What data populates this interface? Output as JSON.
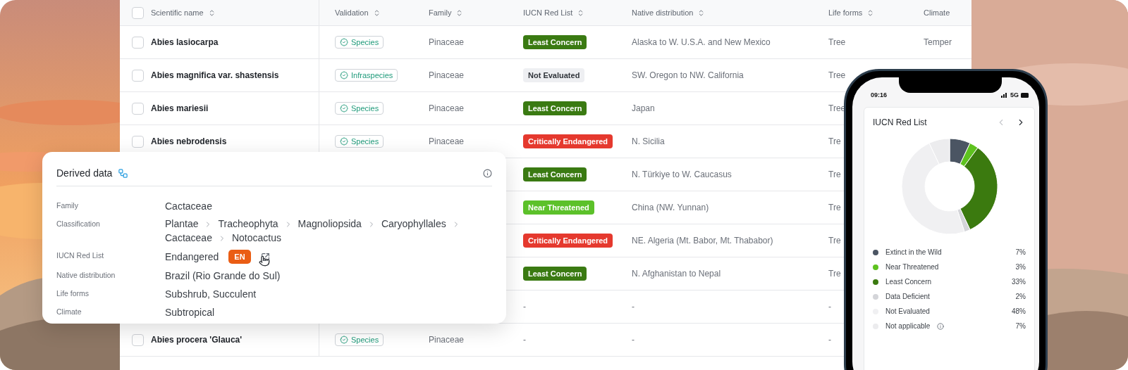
{
  "table": {
    "select_all": {
      "checked": false
    },
    "columns": [
      {
        "label": "Scientific name",
        "sortable": true
      },
      {
        "label": "Validation",
        "sortable": true
      },
      {
        "label": "Family",
        "sortable": true
      },
      {
        "label": "IUCN Red List",
        "sortable": true
      },
      {
        "label": "Native distribution",
        "sortable": true
      },
      {
        "label": "Life forms",
        "sortable": true
      },
      {
        "label": "Climate",
        "sortable": false
      }
    ],
    "rows": [
      {
        "checked": false,
        "name": "Abies lasiocarpa",
        "validation": "Species",
        "family": "Pinaceae",
        "iucn": {
          "label": "Least Concern",
          "kind": "lc"
        },
        "native": "Alaska to W. U.S.A. and New Mexico",
        "life": "Tree",
        "climate": "Temper"
      },
      {
        "checked": false,
        "name": "Abies magnifica var. shastensis",
        "validation": "Infraspecies",
        "family": "Pinaceae",
        "iucn": {
          "label": "Not Evaluated",
          "kind": "ne"
        },
        "native": "SW. Oregon to NW. California",
        "life": "Tree"
      },
      {
        "checked": false,
        "name": "Abies mariesii",
        "validation": "Species",
        "family": "Pinaceae",
        "iucn": {
          "label": "Least Concern",
          "kind": "lc"
        },
        "native": "Japan",
        "life": "Tree"
      },
      {
        "checked": false,
        "name": "Abies nebrodensis",
        "validation": "Species",
        "family": "Pinaceae",
        "iucn": {
          "label": "Critically Endangered",
          "kind": "cr"
        },
        "native": "N. Sicilia",
        "life": "Tre"
      },
      {
        "iucn": {
          "label": "Least Concern",
          "kind": "lc"
        },
        "native": "N. Türkiye to W. Caucasus",
        "life": "Tre"
      },
      {
        "iucn": {
          "label": "Near Threatened",
          "kind": "nt"
        },
        "native": "China (NW. Yunnan)",
        "life": "Tre"
      },
      {
        "iucn": {
          "label": "Critically Endangered",
          "kind": "cr"
        },
        "native": "NE. Algeria (Mt. Babor, Mt. Thababor)",
        "life": "Tre"
      },
      {
        "iucn": {
          "label": "Least Concern",
          "kind": "lc"
        },
        "native": "N. Afghanistan to Nepal",
        "life": "Tre"
      },
      {
        "iucn": {
          "label": "-",
          "kind": "none"
        },
        "native": "-",
        "life": "-"
      },
      {
        "checked": false,
        "name": "Abies procera 'Glauca'",
        "validation": "Species",
        "family": "Pinaceae",
        "iucn": {
          "label": "-",
          "kind": "none"
        },
        "native": "-",
        "life": "-"
      }
    ]
  },
  "derived": {
    "title": "Derived data",
    "fields": [
      {
        "label": "Family",
        "kind": "text",
        "value": "Cactaceae"
      },
      {
        "label": "Classification",
        "kind": "path",
        "items": [
          "Plantae",
          "Tracheophyta",
          "Magnoliopsida",
          "Caryophyllales",
          "Cactaceae",
          "Notocactus"
        ]
      },
      {
        "label": "IUCN Red List",
        "kind": "status",
        "value": "Endangered",
        "badge": "EN"
      },
      {
        "label": "Native distribution",
        "kind": "text",
        "value": "Brazil (Rio Grande do Sul)"
      },
      {
        "label": "Life forms",
        "kind": "text",
        "value": "Subshrub, Succulent"
      },
      {
        "label": "Climate",
        "kind": "text",
        "value": "Subtropical"
      }
    ]
  },
  "phone": {
    "time": "09:16",
    "network": "5G",
    "card": {
      "prev": {
        "disabled": true
      },
      "next": {
        "disabled": false
      },
      "chart_data": {
        "type": "donut",
        "title": "IUCN Red List",
        "categories": [
          "Extinct in the Wild",
          "Near Threatened",
          "Least Concern",
          "Data Deficient",
          "Not Evaluated",
          "Not applicable"
        ],
        "series": [
          {
            "values": [
              7,
              3,
              33,
              2,
              48,
              7
            ]
          }
        ]
      },
      "legend": [
        {
          "value": "7%",
          "color": "#4b5563",
          "info": false
        },
        {
          "value": "3%",
          "color": "#5ec21f",
          "info": false
        },
        {
          "value": "33%",
          "color": "#3b7a0f",
          "info": false
        },
        {
          "value": "2%",
          "color": "#d4d5d9",
          "info": false
        },
        {
          "value": "48%",
          "color": "#f0f0f2",
          "info": false
        },
        {
          "value": "7%",
          "color": "#ececee",
          "info": true
        }
      ]
    }
  }
}
